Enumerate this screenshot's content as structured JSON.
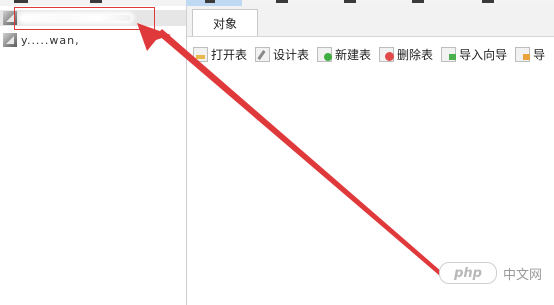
{
  "tabs": {
    "objects_label": "对象"
  },
  "tree": {
    "connection_1_label": "",
    "connection_2_label": "y.....wan,"
  },
  "toolbar": {
    "open_table": "打开表",
    "design_table": "设计表",
    "new_table": "新建表",
    "delete_table": "删除表",
    "import_wizard": "导入向导",
    "export_partial": "导"
  },
  "watermark": {
    "logo_text": "php",
    "site_text": "中文网"
  },
  "colors": {
    "annotation_red": "#e0393b",
    "tab_active_bg": "#ffffff",
    "menu_highlight": "#bfd9f2"
  }
}
